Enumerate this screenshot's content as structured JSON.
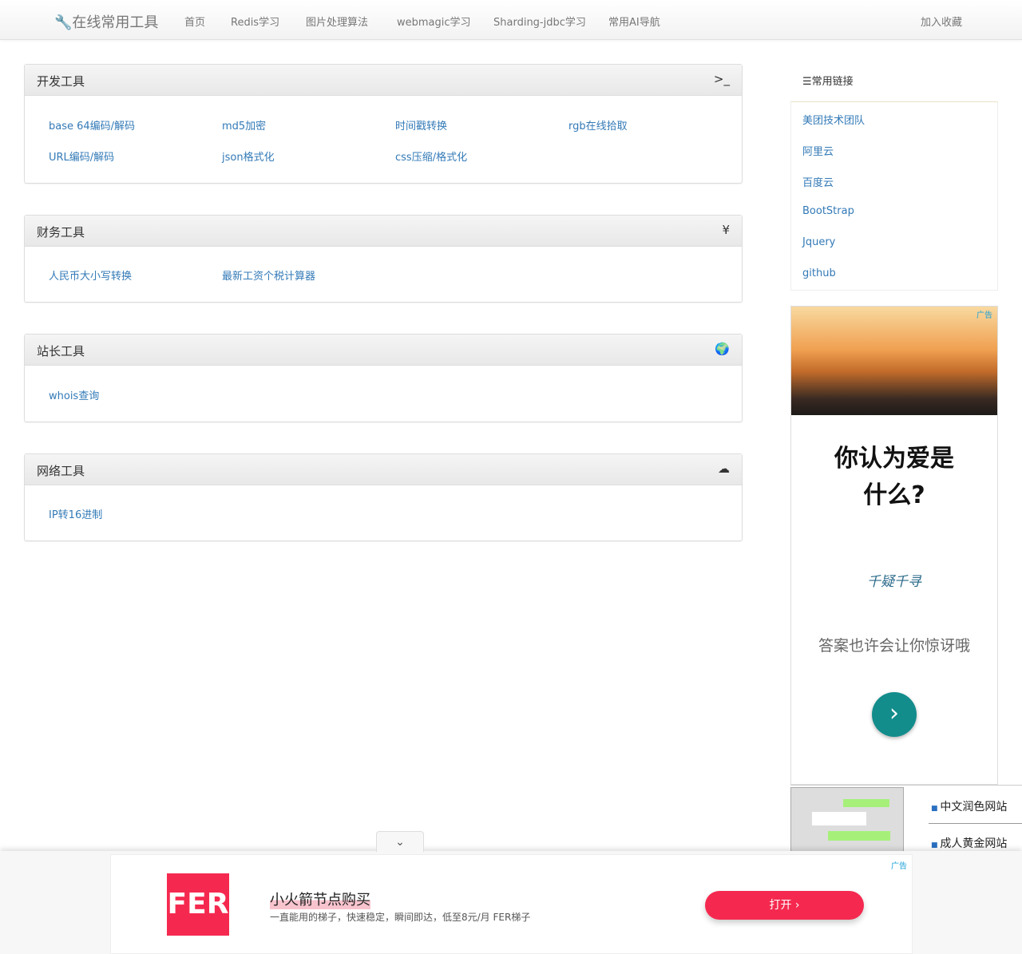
{
  "nav": {
    "brand": "在线常用工具",
    "items": [
      "首页",
      "Redis学习",
      "图片处理算法",
      "webmagic学习",
      "Sharding-jdbc学习",
      "常用AI导航"
    ],
    "bookmark": "加入收藏"
  },
  "panels": [
    {
      "title": "开发工具",
      "icon": "terminal-icon",
      "links": [
        "base 64编码/解码",
        "md5加密",
        "时间戳转换",
        "rgb在线拾取",
        "URL编码/解码",
        "json格式化",
        "css压缩/格式化"
      ]
    },
    {
      "title": "财务工具",
      "icon": "yen-icon",
      "links": [
        "人民币大小写转换",
        "最新工资个税计算器"
      ]
    },
    {
      "title": "站长工具",
      "icon": "globe-icon",
      "links": [
        "whois查询"
      ]
    },
    {
      "title": "网络工具",
      "icon": "cloud-icon",
      "links": [
        "IP转16进制"
      ]
    }
  ],
  "sidebar": {
    "title": "常用链接",
    "links": [
      "美团技术团队",
      "阿里云",
      "百度云",
      "BootStrap",
      "Jquery",
      "github"
    ]
  },
  "ad": {
    "label": "广告",
    "headline1": "你认为爱是",
    "headline2": "什么?",
    "logo": "千疑千寻",
    "sub": "答案也许会让你惊讶哦"
  },
  "ad2": {
    "items": [
      "中文润色网站",
      "成人黄金网站"
    ]
  },
  "bottom_ad": {
    "label": "广告",
    "logo": "FER",
    "title": "小火箭节点购买",
    "desc": "一直能用的梯子，快速稳定，瞬间即达，低至8元/月 FER梯子",
    "button": "打开"
  }
}
